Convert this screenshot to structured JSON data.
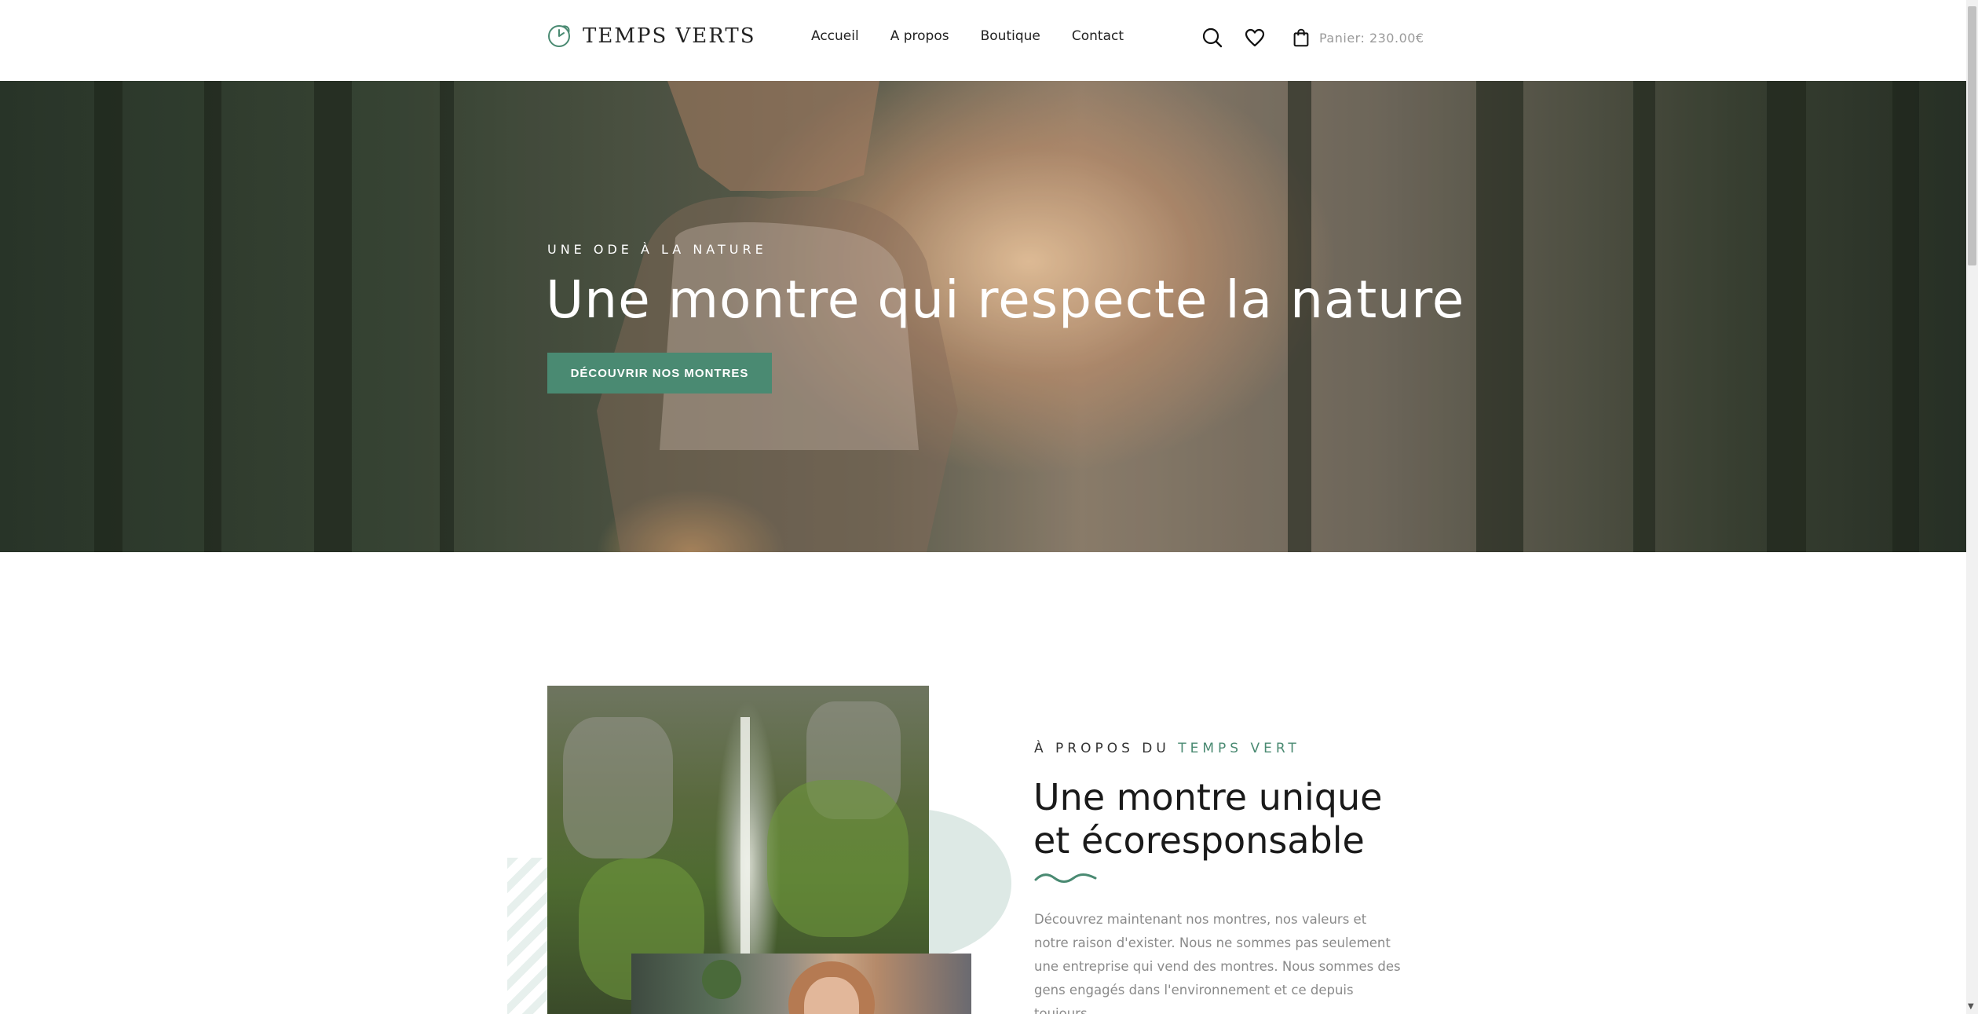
{
  "brand": {
    "name": "TEMPS VERTS",
    "accent": "#4a8a72"
  },
  "nav": {
    "items": [
      {
        "label": "Accueil"
      },
      {
        "label": "A propos"
      },
      {
        "label": "Boutique"
      },
      {
        "label": "Contact"
      }
    ]
  },
  "header_icons": {
    "search": "search-icon",
    "wishlist": "heart-icon",
    "cart": "shopping-bag-icon"
  },
  "cart": {
    "label": "Panier: 230.00€"
  },
  "hero": {
    "eyebrow": "UNE ODE À LA NATURE",
    "title": "Une montre qui respecte la nature",
    "cta": "DÉCOUVRIR NOS MONTRES"
  },
  "about": {
    "eyebrow_prefix": "À PROPOS DU ",
    "eyebrow_accent": "TEMPS VERT",
    "title_line1": "Une montre unique",
    "title_line2": "et écoresponsable",
    "body": "Découvrez maintenant nos montres, nos valeurs et notre raison d'exister. Nous ne sommes pas seulement une entreprise qui vend des montres. Nous sommes des gens engagés dans l'environnement et ce depuis toujours."
  }
}
